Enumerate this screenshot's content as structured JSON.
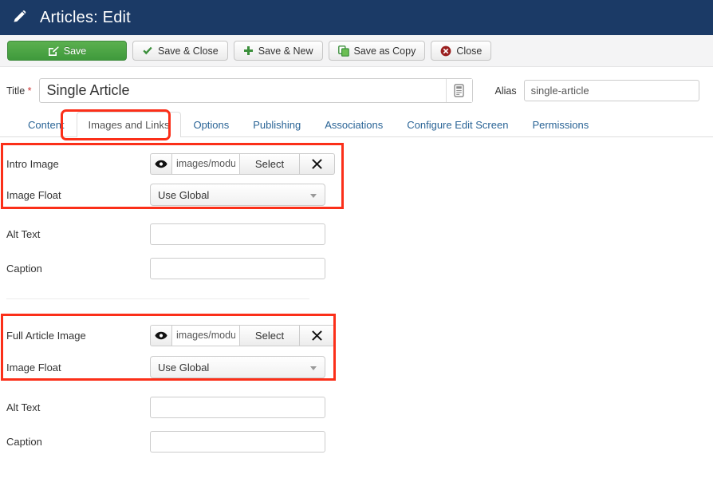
{
  "header": {
    "title": "Articles: Edit",
    "icon": "pencil-icon",
    "background": "#1b3a66"
  },
  "toolbar": {
    "buttons": [
      {
        "label": "Save",
        "icon": "pencil-square-icon",
        "style": "primary",
        "color": "#44a040"
      },
      {
        "label": "Save & Close",
        "icon": "check-icon",
        "style": "default",
        "color": "#3b8f3b"
      },
      {
        "label": "Save & New",
        "icon": "plus-icon",
        "style": "default",
        "color": "#3b8f3b"
      },
      {
        "label": "Save as Copy",
        "icon": "copy-icon",
        "style": "default",
        "color": "#3b8f3b"
      },
      {
        "label": "Close",
        "icon": "circle-x-icon",
        "style": "default",
        "color": "#9a1f1f"
      }
    ]
  },
  "title_row": {
    "label": "Title",
    "required_marker": "*",
    "value": "Single Article",
    "placeholder": "",
    "addon_icon": "article-editor-icon",
    "alias_label": "Alias",
    "alias_value": "single-article",
    "alias_placeholder": ""
  },
  "tabs": {
    "items": [
      {
        "label": "Content",
        "active": false
      },
      {
        "label": "Images and Links",
        "active": true
      },
      {
        "label": "Options",
        "active": false
      },
      {
        "label": "Publishing",
        "active": false
      },
      {
        "label": "Associations",
        "active": false
      },
      {
        "label": "Configure Edit Screen",
        "active": false
      },
      {
        "label": "Permissions",
        "active": false
      }
    ]
  },
  "annotations": {
    "color": "#fb2f19",
    "boxes": [
      {
        "name": "active-tab-highlight",
        "target": "Images and Links"
      },
      {
        "name": "intro-image-highlight",
        "target": "Intro Image + Image Float"
      },
      {
        "name": "full-article-image-highlight",
        "target": "Full Article Image + Image Float"
      }
    ]
  },
  "intro_section": {
    "image_label": "Intro Image",
    "image_value": "images/module:",
    "image_placeholder": "",
    "preview_icon": "eye-icon",
    "select_label": "Select",
    "clear_icon": "x-icon",
    "float_label": "Image Float",
    "float_value": "Use Global",
    "alt_label": "Alt Text",
    "alt_value": "",
    "alt_placeholder": "",
    "caption_label": "Caption",
    "caption_value": "",
    "caption_placeholder": ""
  },
  "full_section": {
    "image_label": "Full Article Image",
    "image_value": "images/module:",
    "image_placeholder": "",
    "preview_icon": "eye-icon",
    "select_label": "Select",
    "clear_icon": "x-icon",
    "float_label": "Image Float",
    "float_value": "Use Global",
    "alt_label": "Alt Text",
    "alt_value": "",
    "alt_placeholder": "",
    "caption_label": "Caption",
    "caption_value": "",
    "caption_placeholder": ""
  }
}
